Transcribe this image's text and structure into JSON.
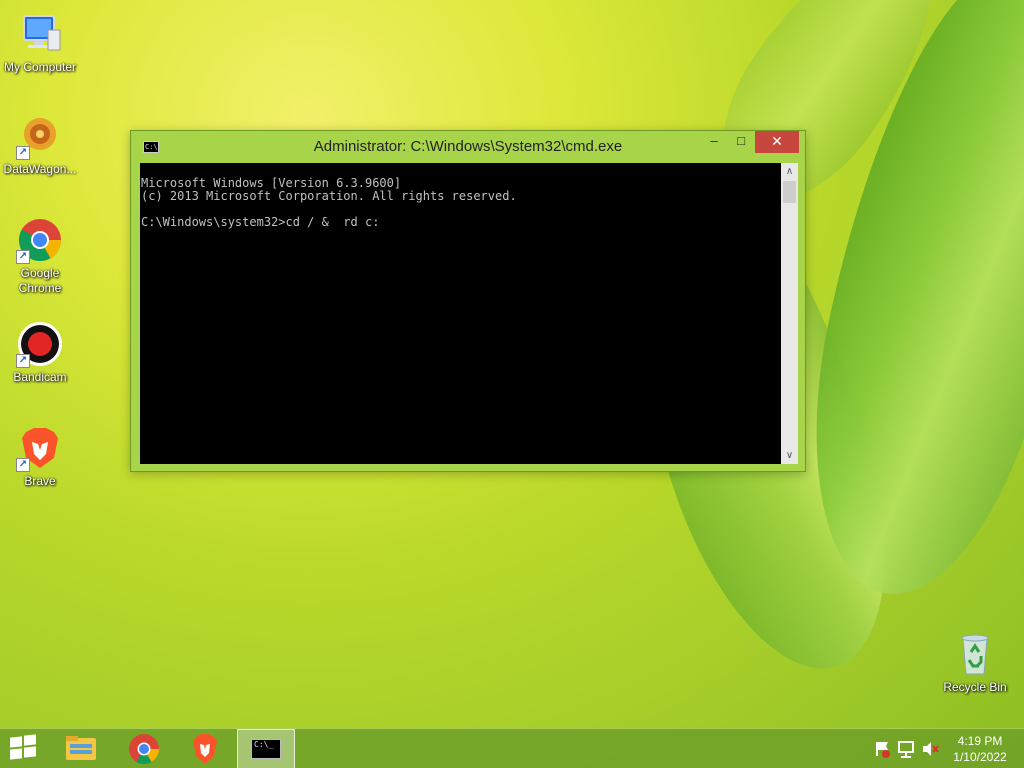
{
  "desktop": {
    "icons": [
      {
        "label": "My Computer"
      },
      {
        "label": "DataWagon..."
      },
      {
        "label": "Google Chrome"
      },
      {
        "label": "Bandicam"
      },
      {
        "label": "Brave"
      },
      {
        "label": "Recycle Bin"
      }
    ]
  },
  "cmd_window": {
    "title": "Administrator: C:\\Windows\\System32\\cmd.exe",
    "icon_text": "C:\\",
    "buttons": {
      "minimize": "–",
      "maximize": "□",
      "close": "✕"
    },
    "lines": [
      "Microsoft Windows [Version 6.3.9600]",
      "(c) 2013 Microsoft Corporation. All rights reserved.",
      "",
      "C:\\Windows\\system32>cd / &  rd c:"
    ],
    "scroll_up": "∧",
    "scroll_down": "∨"
  },
  "taskbar": {
    "items": [
      {
        "name": "file-explorer"
      },
      {
        "name": "google-chrome"
      },
      {
        "name": "brave"
      },
      {
        "name": "command-prompt",
        "active": true,
        "text": "C:\\_"
      }
    ],
    "clock": {
      "time": "4:19 PM",
      "date": "1/10/2022"
    }
  },
  "colors": {
    "accent": "#a8d44a",
    "close": "#c7463e",
    "console_bg": "#000000",
    "console_fg": "#c0c0c0"
  }
}
